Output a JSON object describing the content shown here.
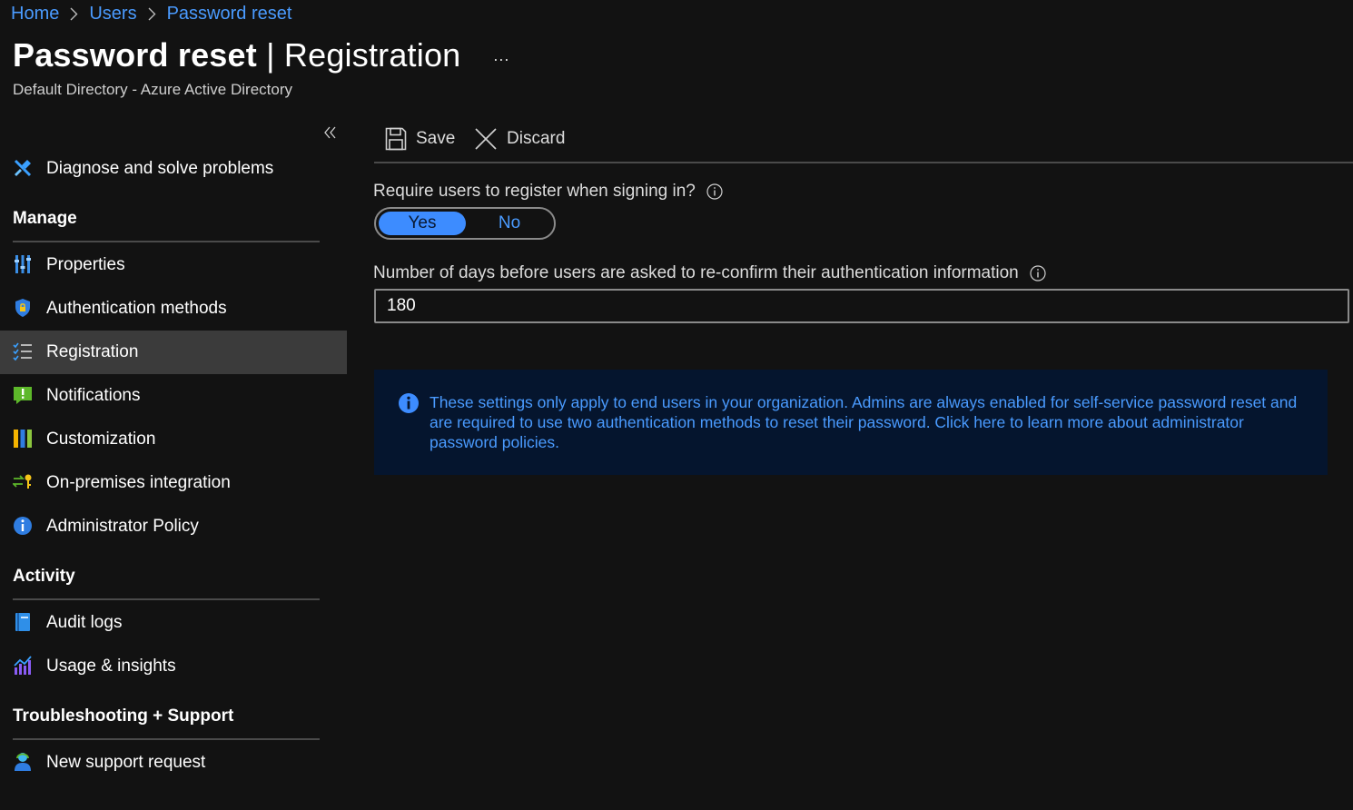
{
  "breadcrumb": {
    "items": [
      {
        "label": "Home"
      },
      {
        "label": "Users"
      },
      {
        "label": "Password reset"
      }
    ]
  },
  "header": {
    "title_main": "Password reset",
    "title_separator": " | ",
    "title_sub": "Registration",
    "more_label": "...",
    "subtitle": "Default Directory - Azure Active Directory"
  },
  "sidebar": {
    "collapse_icon": "double-chevron-left-icon",
    "top_item": {
      "label": "Diagnose and solve problems",
      "icon": "wrench-icon"
    },
    "sections": [
      {
        "title": "Manage",
        "items": [
          {
            "label": "Properties",
            "icon": "properties-icon"
          },
          {
            "label": "Authentication methods",
            "icon": "shield-lock-icon"
          },
          {
            "label": "Registration",
            "icon": "checklist-icon",
            "active": true
          },
          {
            "label": "Notifications",
            "icon": "notification-icon"
          },
          {
            "label": "Customization",
            "icon": "customization-icon"
          },
          {
            "label": "On-premises integration",
            "icon": "sync-key-icon"
          },
          {
            "label": "Administrator Policy",
            "icon": "info-icon"
          }
        ]
      },
      {
        "title": "Activity",
        "items": [
          {
            "label": "Audit logs",
            "icon": "book-icon"
          },
          {
            "label": "Usage & insights",
            "icon": "chart-icon"
          }
        ]
      },
      {
        "title": "Troubleshooting + Support",
        "items": [
          {
            "label": "New support request",
            "icon": "support-person-icon"
          }
        ]
      }
    ]
  },
  "toolbar": {
    "save_label": "Save",
    "discard_label": "Discard"
  },
  "form": {
    "require_register_label": "Require users to register when signing in?",
    "toggle_yes": "Yes",
    "toggle_no": "No",
    "toggle_selected": "Yes",
    "days_label": "Number of days before users are asked to re-confirm their authentication information",
    "days_value": "180"
  },
  "info_banner": {
    "text": "These settings only apply to end users in your organization. Admins are always enabled for self-service password reset and are required to use two authentication methods to reset their password. Click here to learn more about administrator password policies."
  },
  "colors": {
    "background": "#121212",
    "accent": "#3d8cff",
    "link": "#4a9bff",
    "active_nav": "#3b3b3b",
    "banner_bg": "#05152e"
  }
}
